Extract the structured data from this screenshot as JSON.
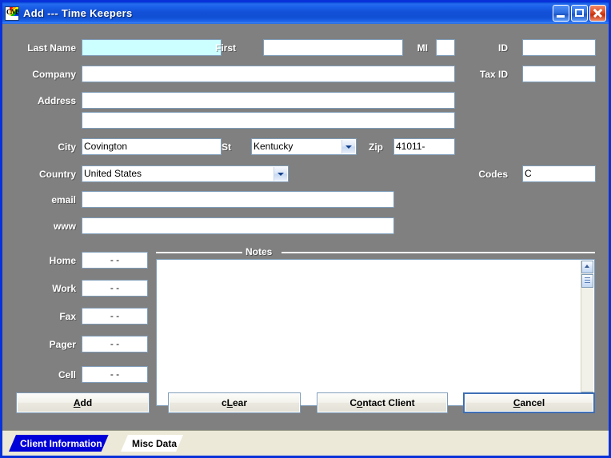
{
  "window": {
    "title": "Add --- Time Keepers",
    "icon": "cms-rainbow-icon",
    "controls": {
      "minimize": "minimize-button",
      "maximize": "maximize-button",
      "close": "close-button"
    },
    "colors": {
      "titlebar_blue": "#0831d9",
      "form_background": "#808080",
      "focused_field": "#ccffff",
      "field_border": "#7f9db9",
      "tabstrip_background": "#ece9d8",
      "selected_tab": "#0000d8"
    }
  },
  "form": {
    "labels": {
      "last_name": "Last Name",
      "first": "First",
      "mi": "MI",
      "id": "ID",
      "company": "Company",
      "tax_id": "Tax ID",
      "address": "Address",
      "city": "City",
      "st": "St",
      "zip": "Zip",
      "country": "Country",
      "codes": "Codes",
      "email": "email",
      "www": "www",
      "home": "Home",
      "work": "Work",
      "fax": "Fax",
      "pager": "Pager",
      "cell": "Cell"
    },
    "values": {
      "last_name": "",
      "first": "",
      "mi": "",
      "id": "",
      "company": "",
      "tax_id": "",
      "address1": "",
      "address2": "",
      "city": "Covington",
      "st": "Kentucky",
      "zip": "41011-",
      "country": "United States",
      "codes": "C",
      "email": "",
      "www": "",
      "home": "-     -",
      "work": "-     -",
      "fax": "-     -",
      "pager": "-     -",
      "cell": "-     -"
    },
    "placeholders": {
      "last_name": "",
      "first": "",
      "mi": "",
      "id": "",
      "company": "",
      "tax_id": "",
      "address1": "",
      "address2": "",
      "email": "",
      "www": ""
    },
    "focused_field": "last_name"
  },
  "notes": {
    "caption": "Notes",
    "value": "",
    "scrollbar": {
      "up": "scroll-up-arrow",
      "thumb": "scroll-thumb",
      "down": "scroll-down-arrow"
    }
  },
  "buttons": {
    "add": "Add",
    "add_accel": "A",
    "clear": "cLear",
    "clear_accel": "L",
    "contact_client": "Contact Client",
    "contact_client_accel": "o",
    "cancel": "Cancel",
    "cancel_accel": "C",
    "default_button": "cancel"
  },
  "tabs": {
    "items": [
      {
        "label": "Client Information",
        "selected": true
      },
      {
        "label": "Misc Data",
        "selected": false
      }
    ]
  }
}
